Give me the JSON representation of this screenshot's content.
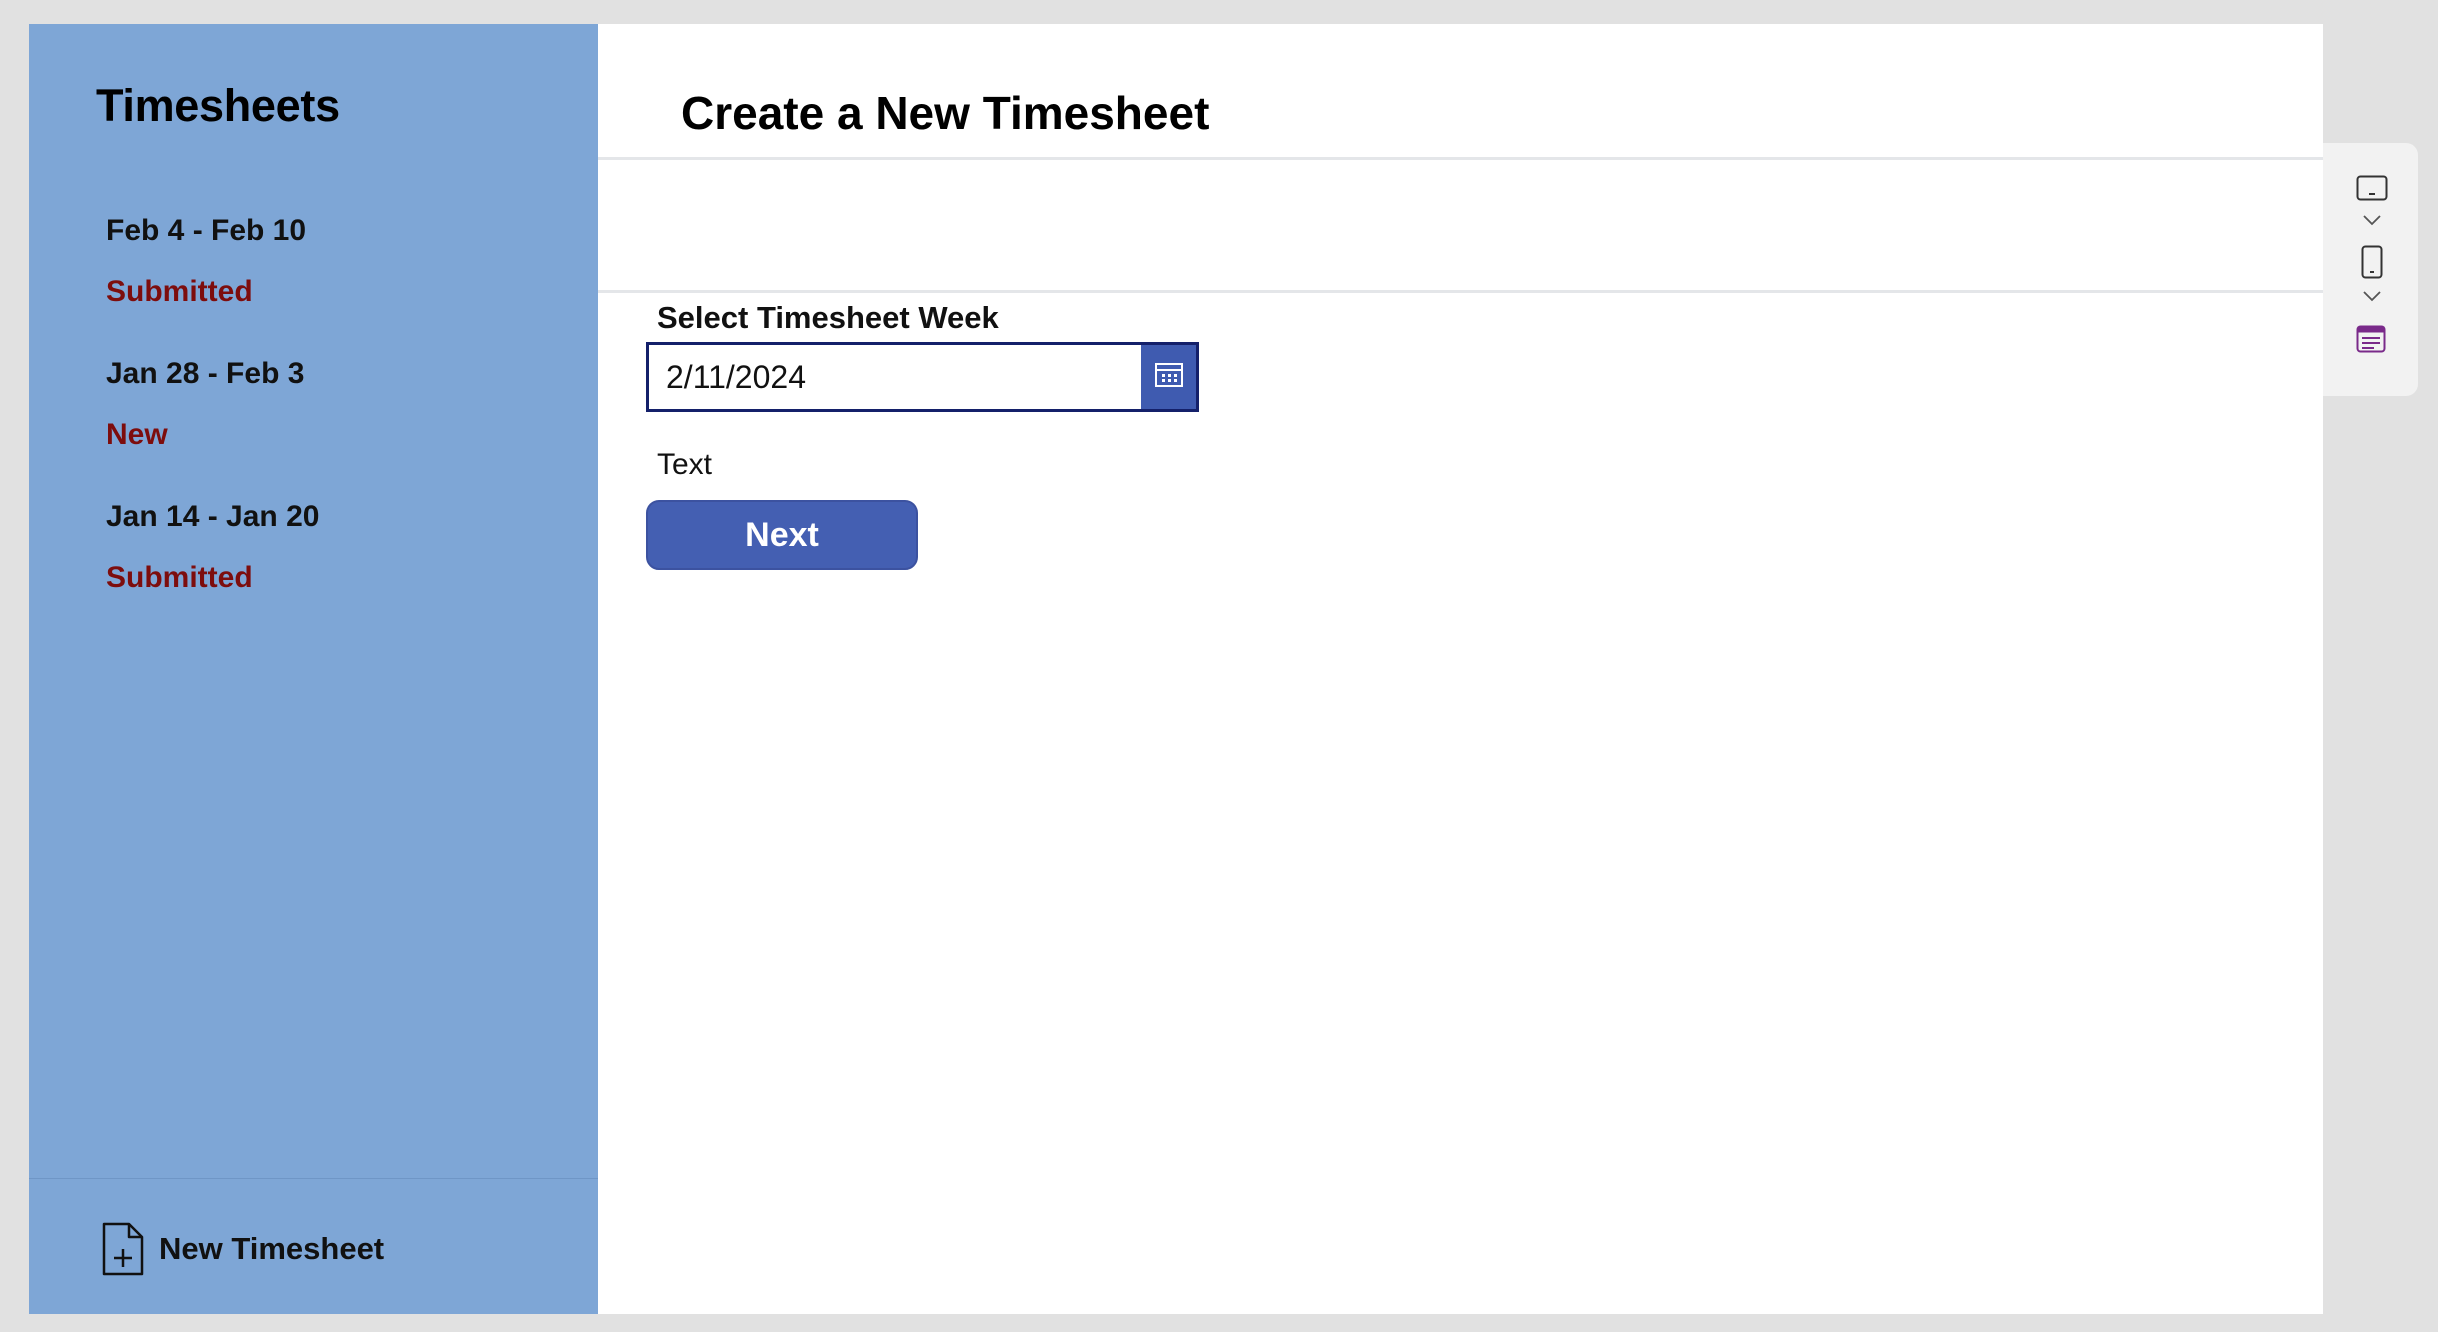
{
  "sidebar": {
    "title": "Timesheets",
    "items": [
      {
        "dates": "Feb 4 - Feb 10",
        "status": "Submitted"
      },
      {
        "dates": "Jan 28 - Feb 3",
        "status": "New"
      },
      {
        "dates": "Jan 14 - Jan 20",
        "status": "Submitted"
      }
    ],
    "new_timesheet": {
      "label": "New Timesheet",
      "icon": "document-add-icon"
    }
  },
  "main": {
    "title": "Create a New Timesheet",
    "week_field": {
      "label": "Select Timesheet Week",
      "value": "2/11/2024",
      "icon": "calendar-icon"
    },
    "text_label": "Text",
    "next_button": "Next"
  },
  "toolbar": {
    "icons": [
      "tablet-layout-icon",
      "chevron-down-icon",
      "phone-layout-icon",
      "chevron-down-icon",
      "form-icon"
    ]
  },
  "colors": {
    "sidebar_bg": "#7ea6d6",
    "status_text": "#7d0d0d",
    "accent": "#445fb2",
    "input_border": "#14206a",
    "form_icon": "#7a2a8a"
  }
}
